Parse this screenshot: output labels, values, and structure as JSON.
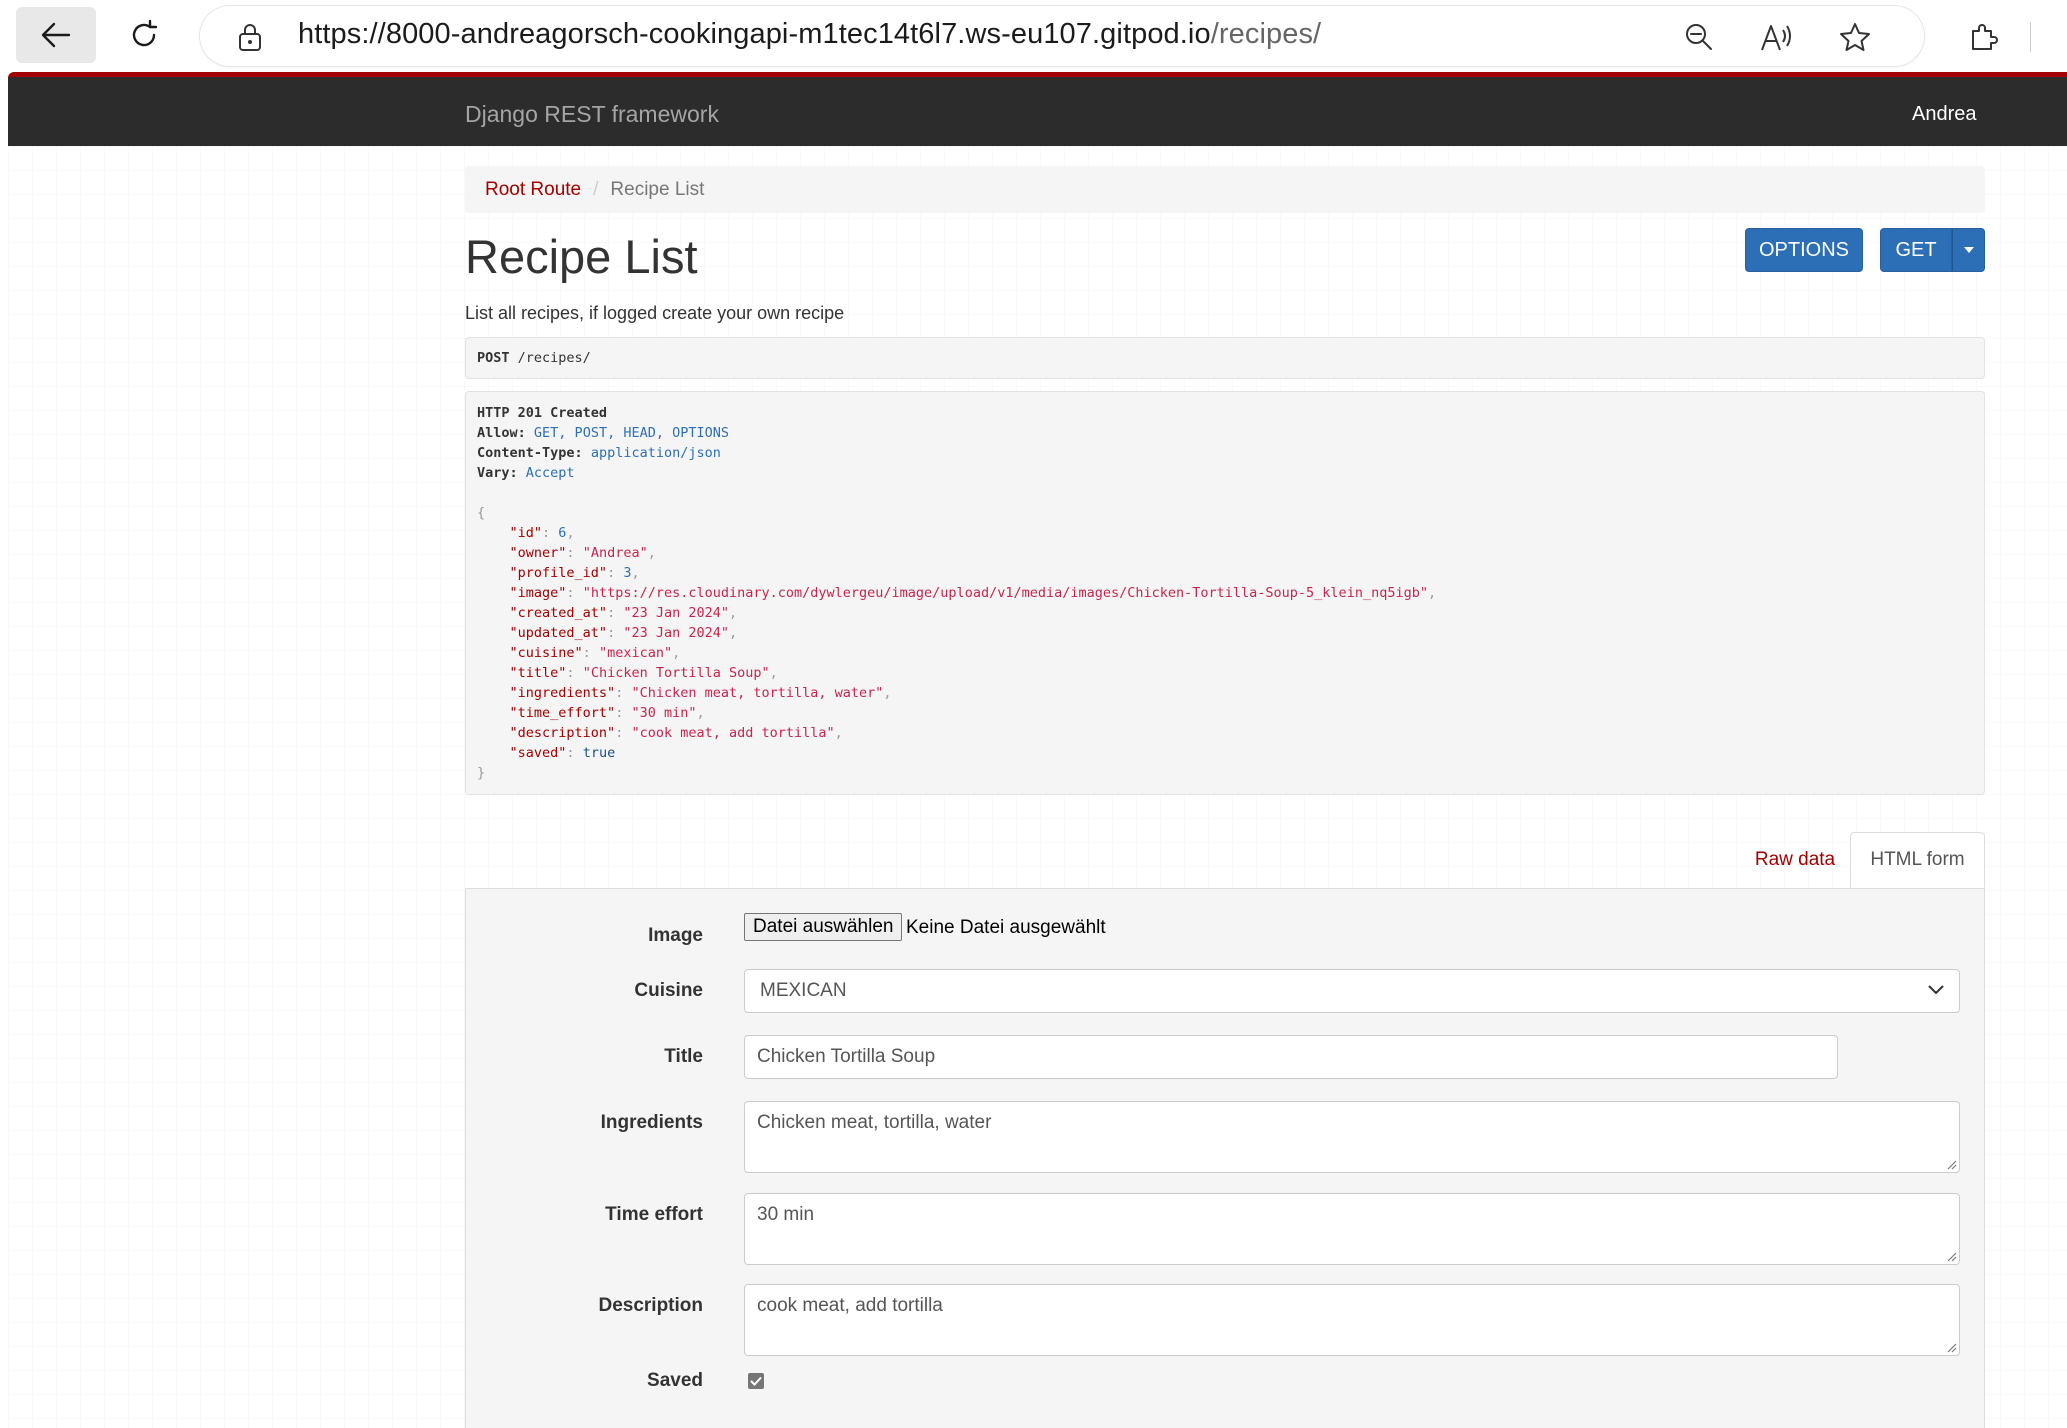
{
  "browser": {
    "url_host": "https://8000-andreagorsch-cookingapi-m1tec14t6l7.ws-eu107.gitpod.io",
    "url_path": "/recipes/",
    "icons": [
      "back-arrow-icon",
      "reload-icon",
      "lock-icon",
      "zoom-out-icon",
      "read-aloud-icon",
      "favorite-star-icon",
      "extensions-icon"
    ]
  },
  "navbar": {
    "brand": "Django REST framework",
    "user": "Andrea"
  },
  "breadcrumb": {
    "root": "Root Route",
    "current": "Recipe List"
  },
  "page": {
    "title": "Recipe List",
    "description": "List all recipes, if logged create your own recipe",
    "options_label": "OPTIONS",
    "get_label": "GET"
  },
  "request": {
    "method": "POST",
    "path": "/recipes/"
  },
  "response": {
    "status": "HTTP 201 Created",
    "headers": [
      {
        "name": "Allow:",
        "value": "GET, POST, HEAD, OPTIONS"
      },
      {
        "name": "Content-Type:",
        "value": "application/json"
      },
      {
        "name": "Vary:",
        "value": "Accept"
      }
    ],
    "json_open": "{",
    "json_close": "}",
    "json": {
      "id_key": "\"id\"",
      "id_val": "6",
      "owner_key": "\"owner\"",
      "owner_val": "\"Andrea\"",
      "profile_id_key": "\"profile_id\"",
      "profile_id_val": "3",
      "image_key": "\"image\"",
      "image_val": "\"https://res.cloudinary.com/dywlergeu/image/upload/v1/media/images/Chicken-Tortilla-Soup-5_klein_nq5igb\"",
      "created_at_key": "\"created_at\"",
      "created_at_val": "\"23 Jan 2024\"",
      "updated_at_key": "\"updated_at\"",
      "updated_at_val": "\"23 Jan 2024\"",
      "cuisine_key": "\"cuisine\"",
      "cuisine_val": "\"mexican\"",
      "title_key": "\"title\"",
      "title_val": "\"Chicken Tortilla Soup\"",
      "ingredients_key": "\"ingredients\"",
      "ingredients_val": "\"Chicken meat, tortilla, water\"",
      "time_effort_key": "\"time_effort\"",
      "time_effort_val": "\"30 min\"",
      "description_key": "\"description\"",
      "description_val": "\"cook meat, add tortilla\"",
      "saved_key": "\"saved\"",
      "saved_val": "true"
    }
  },
  "tabs": {
    "raw": "Raw data",
    "html": "HTML form"
  },
  "form": {
    "image_label": "Image",
    "file_button": "Datei auswählen",
    "file_status": "Keine Datei ausgewählt",
    "cuisine_label": "Cuisine",
    "cuisine_value": "MEXICAN",
    "title_label": "Title",
    "title_value": "Chicken Tortilla Soup",
    "ingredients_label": "Ingredients",
    "ingredients_value": "Chicken meat, tortilla, water",
    "time_effort_label": "Time effort",
    "time_effort_value": "30 min",
    "description_label": "Description",
    "description_value": "cook meat, add tortilla",
    "saved_label": "Saved",
    "saved_checked": true
  },
  "colors": {
    "accent": "#a30000",
    "button": "#2c6fb6",
    "navbar": "#2c2c2c"
  }
}
